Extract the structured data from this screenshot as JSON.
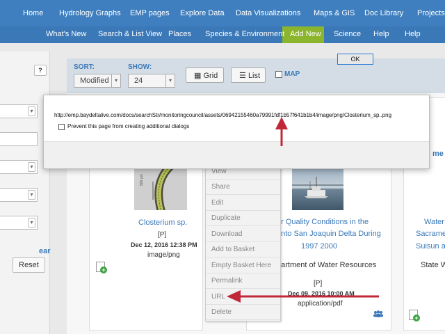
{
  "nav_primary": [
    "Home",
    "Hydrology Graphs",
    "EMP pages",
    "Explore Data",
    "Data Visualizations",
    "Maps & GIS",
    "Doc Library",
    "Projects"
  ],
  "nav_secondary": [
    "What's New",
    "Search & List View",
    "Places",
    "Species & Environment",
    "Add New",
    "Science",
    "Help",
    "Help"
  ],
  "sidebar": {
    "help_button": "?",
    "link_partial": "ear",
    "reset_label": "Reset"
  },
  "toolbar": {
    "sort_label": "SORT:",
    "sort_value": "Modified",
    "show_label": "SHOW:",
    "show_value": "24",
    "grid_label": "Grid",
    "list_label": "List",
    "map_label": "MAP"
  },
  "cards": [
    {
      "title": "Closterium sp.",
      "tag": "[P]",
      "date": "Dec 12, 2016 12:38 PM",
      "type": "image/png",
      "thumb_label": "500 µm"
    },
    {
      "title_lines": [
        "er Quality Conditions in the",
        "ento San Joaquin Delta During",
        "1997 2000"
      ],
      "agency": "partment of Water Resources",
      "tag": "[P]",
      "date": "Dec 09, 2016 10:00 AM",
      "type": "application/pdf"
    },
    {
      "title_partial": "me",
      "lines": [
        "Water",
        "Sacrame",
        "Suisun an",
        "State Wa"
      ]
    }
  ],
  "context_menu": [
    "View",
    "Share",
    "Edit",
    "Duplicate",
    "Download",
    "Add to Basket",
    "Empty Basket Here",
    "Permalink",
    "URL",
    "Delete"
  ],
  "dialog": {
    "message": "http://emp.baydeltalive.com/docs/searchStr/monitoringcouncil/assets/06942155460a79991fdf1b57f641b1b4/image/png/Closterium_sp..png",
    "checkbox_label": "Prevent this page from creating additional dialogs",
    "ok_label": "OK"
  },
  "colors": {
    "nav": "#3f7fbf",
    "accent_green": "#8ab52c",
    "link": "#3a78b8",
    "arrow": "#c0283a"
  },
  "icons": [
    "sort-caret-icon",
    "grid-icon",
    "list-icon",
    "add-to-basket-icon",
    "users-icon",
    "red-arrow-icon"
  ]
}
